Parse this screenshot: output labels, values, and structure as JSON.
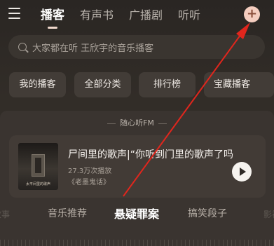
{
  "header": {
    "tabs": [
      {
        "label": "播客",
        "active": true
      },
      {
        "label": "有声书",
        "active": false
      },
      {
        "label": "广播剧",
        "active": false
      },
      {
        "label": "听听",
        "active": false
      }
    ],
    "add_icon": "plus-icon",
    "add_glyph": "+"
  },
  "search": {
    "placeholder": "大家都在听 王欣宇的音乐播客"
  },
  "categories": [
    {
      "label": "我的播客"
    },
    {
      "label": "全部分类"
    },
    {
      "label": "排行榜"
    },
    {
      "label": "宝藏播客"
    }
  ],
  "fm": {
    "title": "随心听FM",
    "item": {
      "title": "尸间里的歌声|“你听到门里的歌声了吗",
      "plays": "27.3万次播放",
      "album": "《老墨鬼话》",
      "cover_caption": "太平间里的歌声"
    },
    "channels": [
      {
        "label": "故事"
      },
      {
        "label": "音乐推荐"
      },
      {
        "label": "悬疑罪案",
        "active": true
      },
      {
        "label": "搞笑段子"
      },
      {
        "label": "影视"
      }
    ]
  },
  "colors": {
    "background": "#2f2b27",
    "accent_add_button": "#f4cdbf",
    "annotation_arrow": "#e0261d"
  }
}
